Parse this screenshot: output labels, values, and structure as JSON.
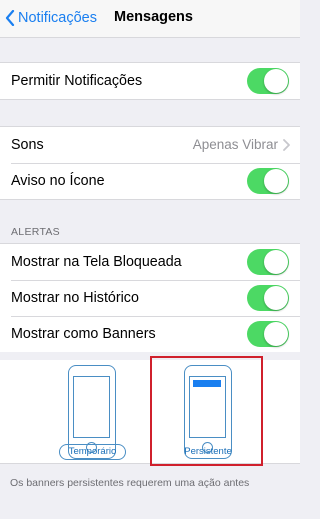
{
  "nav": {
    "back_label": "Notificações",
    "title": "Mensagens"
  },
  "group1": {
    "allow_notifications": {
      "label": "Permitir Notificações",
      "on": true
    }
  },
  "group2": {
    "sounds": {
      "label": "Sons",
      "value": "Apenas Vibrar"
    },
    "badge": {
      "label": "Aviso no Ícone",
      "on": true
    }
  },
  "alerts": {
    "header": "ALERTAS",
    "lock_screen": {
      "label": "Mostrar na Tela Bloqueada",
      "on": true
    },
    "history": {
      "label": "Mostrar no Histórico",
      "on": true
    },
    "banners": {
      "label": "Mostrar como Banners",
      "on": true
    }
  },
  "banner_styles": {
    "temporary_label": "Temporário",
    "persistent_label": "Persistente",
    "selected": "persistent"
  },
  "footer_text": "Os banners persistentes requerem uma ação antes",
  "colors": {
    "accent": "#1a7ff0",
    "toggle_on": "#4cd964",
    "highlight": "#d0202c",
    "background": "#efeff4"
  }
}
